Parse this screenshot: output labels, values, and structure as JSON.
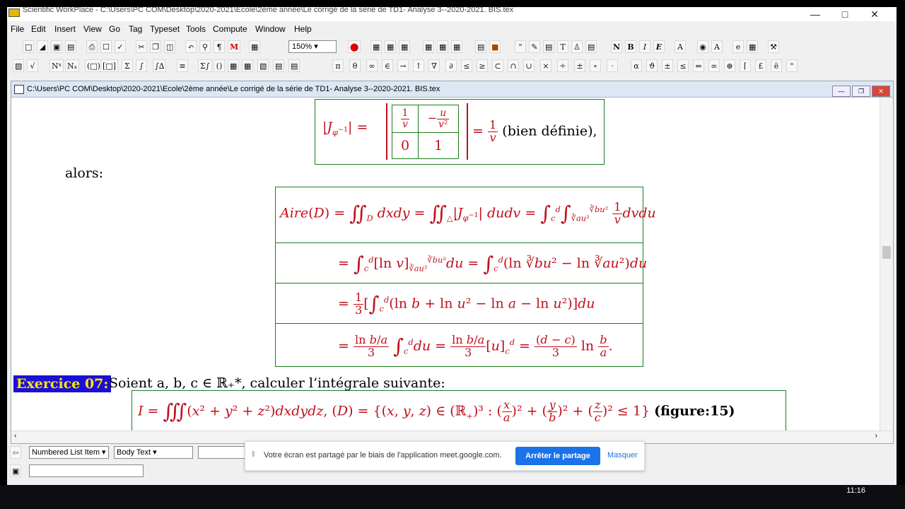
{
  "app": {
    "title": "Scientific WorkPlace - C:\\Users\\PC COM\\Desktop\\2020-2021\\Ecole\\2ème année\\Le corrigé de la série de TD1- Analyse 3--2020-2021. BIS.tex"
  },
  "menu": [
    "File",
    "Edit",
    "Insert",
    "View",
    "Go",
    "Tag",
    "Typeset",
    "Tools",
    "Compute",
    "Window",
    "Help"
  ],
  "toolbar": {
    "zoom": "150%"
  },
  "document": {
    "path": "C:\\Users\\PC COM\\Desktop\\2020-2021\\Ecole\\2ème année\\Le corrigé de la série de TD1- Analyse 3--2020-2021. BIS.tex",
    "jacobian_suffix": "(bien définie),",
    "alors": "alors:",
    "exercise_label": "Exercice 07:",
    "exercise_text": "Soient a, b, c ∈ ℝ₊*, calculer l’intégrale suivante:",
    "figure_ref": "(figure:15)"
  },
  "status": {
    "list_item": "Numbered List Item",
    "body_text": "Body Text"
  },
  "meet": {
    "message": "Votre écran est partagé par le biais de l'application meet.google.com.",
    "stop": "Arrêter le partage",
    "hide": "Masquer"
  },
  "taskbar": {
    "time": "11:16"
  }
}
